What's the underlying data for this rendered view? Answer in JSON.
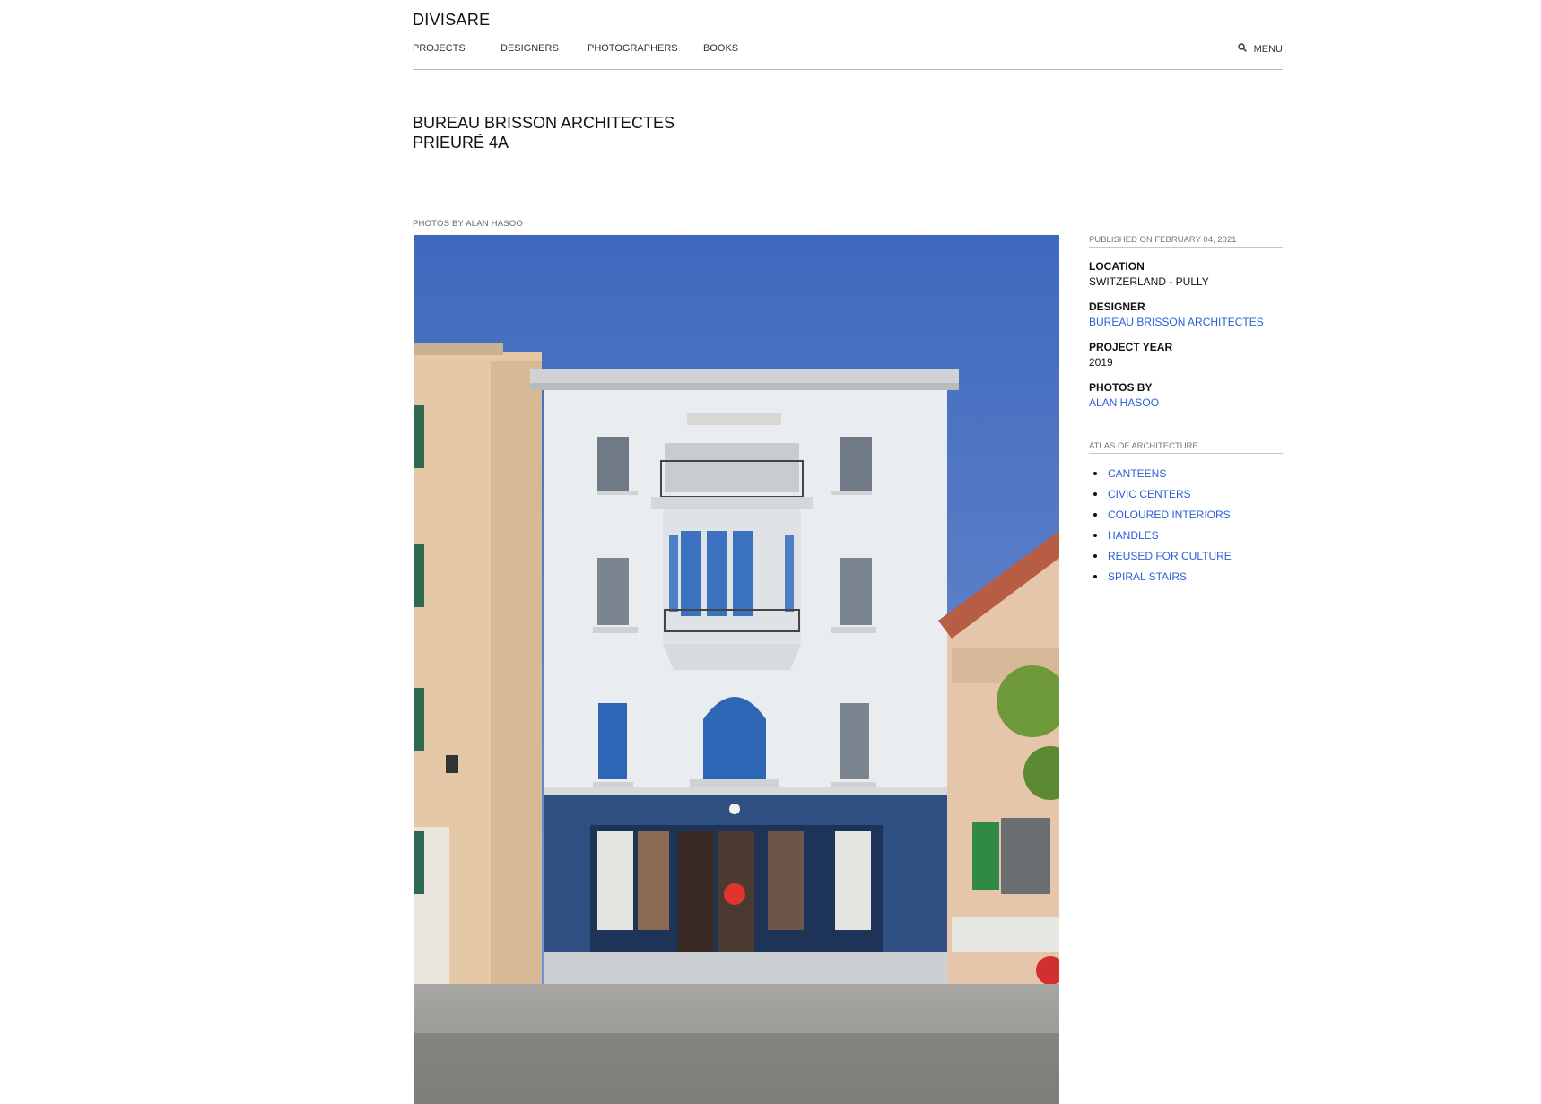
{
  "site": {
    "logo": "DIVISARE"
  },
  "nav": {
    "items": [
      {
        "label": "PROJECTS"
      },
      {
        "label": "DESIGNERS"
      },
      {
        "label": "PHOTOGRAPHERS"
      },
      {
        "label": "BOOKS"
      }
    ],
    "menu_label": "MENU"
  },
  "project": {
    "designer_line": "BUREAU BRISSON ARCHITECTES",
    "name_line": "PRIEURÉ 4A",
    "photo_credit": "PHOTOS BY ALAN HASOO"
  },
  "sidebar": {
    "published": "PUBLISHED ON FEBRUARY 04, 2021",
    "location_label": "LOCATION",
    "location_value": "SWITZERLAND - PULLY",
    "designer_label": "DESIGNER",
    "designer_value": "BUREAU BRISSON ARCHITECTES",
    "year_label": "PROJECT YEAR",
    "year_value": "2019",
    "photos_label": "PHOTOS BY",
    "photos_value": "ALAN HASOO",
    "atlas_label": "ATLAS OF ARCHITECTURE",
    "atlas_items": [
      {
        "label": "CANTEENS"
      },
      {
        "label": "CIVIC CENTERS"
      },
      {
        "label": "COLOURED INTERIORS"
      },
      {
        "label": "HANDLES"
      },
      {
        "label": "REUSED FOR CULTURE"
      },
      {
        "label": "SPIRAL STAIRS"
      }
    ]
  },
  "colors": {
    "link": "#2b5ed8",
    "sky": "#4a73c2",
    "facade_white": "#e6eaee",
    "ground_floor_blue": "#2f4f82",
    "shutter_blue": "#2d66b5",
    "neighbor_beige": "#e7c9a7"
  },
  "icons": {
    "search": "search-icon"
  }
}
